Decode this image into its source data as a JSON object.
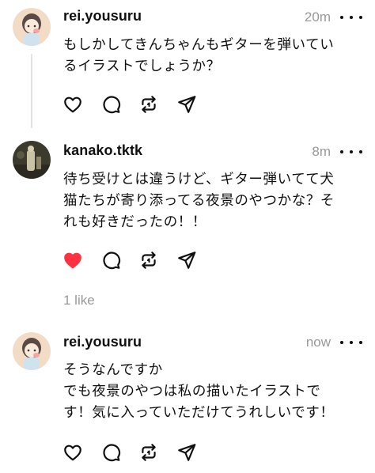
{
  "posts": [
    {
      "username": "rei.yousuru",
      "time": "20m",
      "text": "もしかしてきんちゃんもギターを弾いてい\nるイラストでしょうか？",
      "liked": false
    },
    {
      "username": "kanako.tktk",
      "time": "8m",
      "text": "待ち受けとは違うけど、ギター弾いてて犬\n猫たちが寄り添ってる夜景のやつかな？そ\nれも好きだったの！！",
      "liked": true,
      "likes": "1 like"
    },
    {
      "username": "rei.yousuru",
      "time": "now",
      "text": "そうなんですか\nでも夜景のやつは私の描いたイラストで\nす！気に入っていただけてうれしいです！",
      "liked": false
    }
  ],
  "colors": {
    "liked": "#ff3040",
    "muted": "#999999",
    "text": "#101010",
    "thread_line": "#e3e3e3"
  },
  "icons": [
    "heart-icon",
    "comment-icon",
    "repost-icon",
    "share-icon",
    "more-icon"
  ]
}
